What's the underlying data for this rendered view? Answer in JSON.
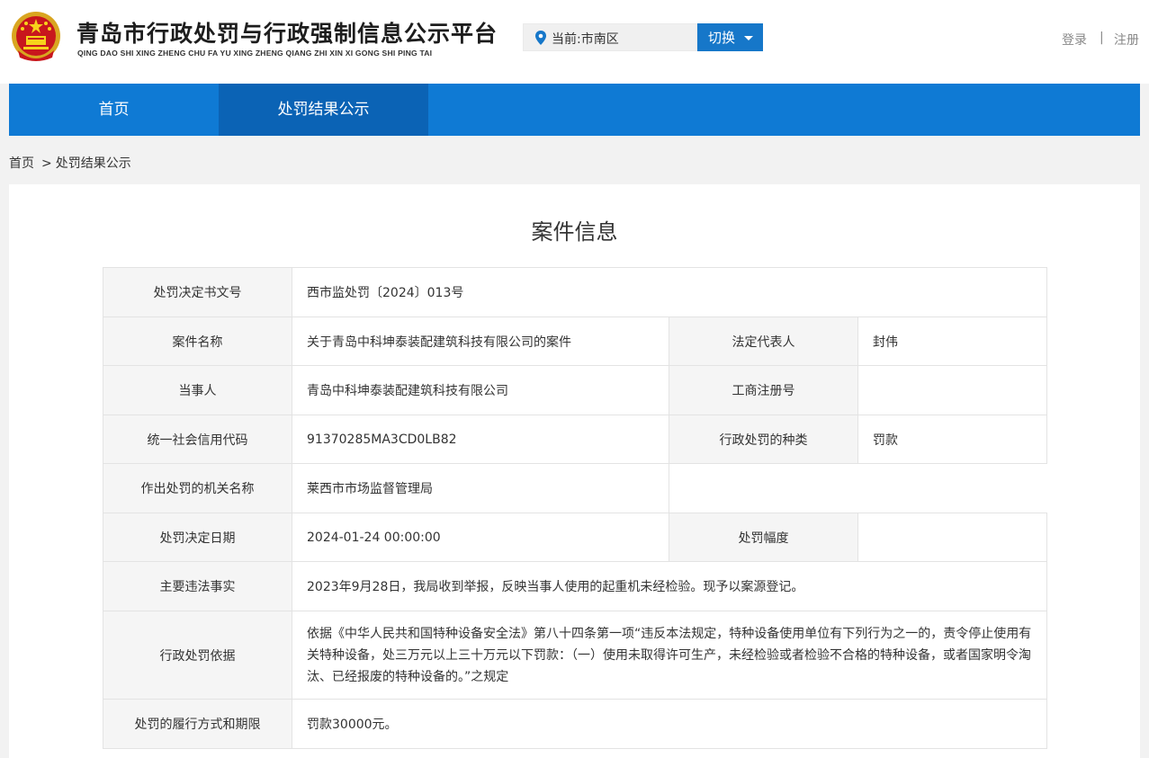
{
  "header": {
    "title": "青岛市行政处罚与行政强制信息公示平台",
    "subtitle": "QING DAO SHI XING ZHENG CHU FA YU XING ZHENG QIANG ZHI XIN XI GONG SHI PING TAI",
    "emblem_icon": "national-emblem-icon",
    "location_icon": "location-pin-icon",
    "location_text": "当前:市南区",
    "switch_label": "切换",
    "login_label": "登录",
    "separator": "|",
    "register_label": "注册"
  },
  "nav": {
    "items": [
      {
        "label": "首页"
      },
      {
        "label": "处罚结果公示"
      }
    ],
    "active_index": 1
  },
  "breadcrumb": {
    "home": "首页",
    "separator": ">",
    "current": "处罚结果公示"
  },
  "panel": {
    "title": "案件信息"
  },
  "case": {
    "decision_no_label": "处罚决定书文号",
    "decision_no": "西市监处罚〔2024〕013号",
    "case_name_label": "案件名称",
    "case_name": "关于青岛中科坤泰装配建筑科技有限公司的案件",
    "legal_rep_label": "法定代表人",
    "legal_rep": "封伟",
    "party_label": "当事人",
    "party": "青岛中科坤泰装配建筑科技有限公司",
    "biz_reg_label": "工商注册号",
    "biz_reg": "",
    "credit_code_label": "统一社会信用代码",
    "credit_code": "91370285MA3CD0LB82",
    "penalty_type_label": "行政处罚的种类",
    "penalty_type": "罚款",
    "authority_label": "作出处罚的机关名称",
    "authority": "莱西市市场监督管理局",
    "decision_date_label": "处罚决定日期",
    "decision_date": "2024-01-24 00:00:00",
    "penalty_range_label": "处罚幅度",
    "penalty_range": "",
    "facts_label": "主要违法事实",
    "facts": "2023年9月28日，我局收到举报，反映当事人使用的起重机未经检验。现予以案源登记。",
    "basis_label": "行政处罚依据",
    "basis": "依据《中华人民共和国特种设备安全法》第八十四条第一项“违反本法规定，特种设备使用单位有下列行为之一的，责令停止使用有关特种设备，处三万元以上三十万元以下罚款：（一）使用未取得许可生产，未经检验或者检验不合格的特种设备，或者国家明令淘汰、已经报废的特种设备的。”之规定",
    "performance_label": "处罚的履行方式和期限",
    "performance": "罚款30000元。"
  },
  "colors": {
    "nav_bg": "#0f7ad4",
    "nav_active_bg": "#0b63b5",
    "switch_bg": "#1677c9",
    "label_bg": "#f5f5f5",
    "page_bg": "#f2f2f2"
  }
}
